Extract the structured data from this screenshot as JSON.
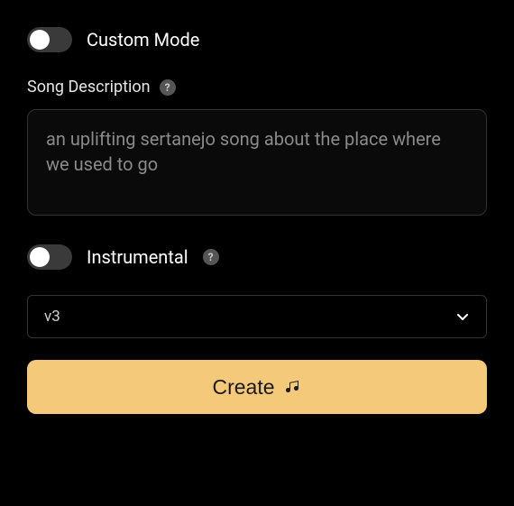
{
  "customMode": {
    "label": "Custom Mode",
    "enabled": false
  },
  "songDescription": {
    "label": "Song Description",
    "placeholder": "an uplifting sertanejo song about the place where we used to go",
    "value": ""
  },
  "instrumental": {
    "label": "Instrumental",
    "enabled": false
  },
  "versionSelect": {
    "selected": "v3"
  },
  "createButton": {
    "label": "Create"
  },
  "colors": {
    "accent": "#f5c97a",
    "background": "#000000"
  }
}
